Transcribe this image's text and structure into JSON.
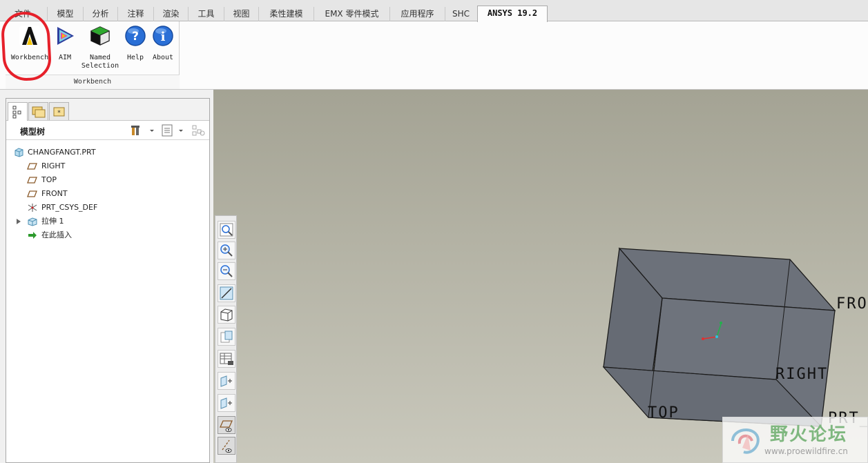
{
  "ribbon": {
    "tabs": [
      "文件",
      "模型",
      "分析",
      "注释",
      "渲染",
      "工具",
      "视图",
      "柔性建模",
      "EMX 零件模式",
      "应用程序",
      "SHC",
      "ANSYS 19.2"
    ],
    "active_tab": "ANSYS 19.2",
    "buttons": [
      {
        "label": "Workbench",
        "icon": "ansys-workbench-icon"
      },
      {
        "label": "AIM",
        "icon": "ansys-aim-icon"
      },
      {
        "label": "Named\nSelection",
        "icon": "named-selection-cube-icon"
      },
      {
        "label": "Help",
        "icon": "help-icon"
      },
      {
        "label": "About",
        "icon": "info-icon"
      }
    ],
    "group_label": "Workbench"
  },
  "model_tree": {
    "title": "模型树",
    "items": [
      {
        "label": "CHANGFANGT.PRT",
        "icon": "part-icon"
      },
      {
        "label": "RIGHT",
        "icon": "datum-plane-icon"
      },
      {
        "label": "TOP",
        "icon": "datum-plane-icon"
      },
      {
        "label": "FRONT",
        "icon": "datum-plane-icon"
      },
      {
        "label": "PRT_CSYS_DEF",
        "icon": "coordinate-system-icon"
      },
      {
        "label": "拉伸 1",
        "icon": "extrude-icon"
      },
      {
        "label": "在此插入",
        "icon": "insert-here-arrow-icon"
      }
    ]
  },
  "viewport": {
    "datum_labels": {
      "front": "FRO",
      "right": "RIGHT",
      "top": "TOP",
      "csys": "PRT_"
    }
  },
  "watermark": {
    "main": "野火论坛",
    "url": "www.proewildfire.cn"
  },
  "colors": {
    "annotation": "#e6202a",
    "box_face": "#6a7079",
    "ansys_yellow": "#f2c200"
  }
}
